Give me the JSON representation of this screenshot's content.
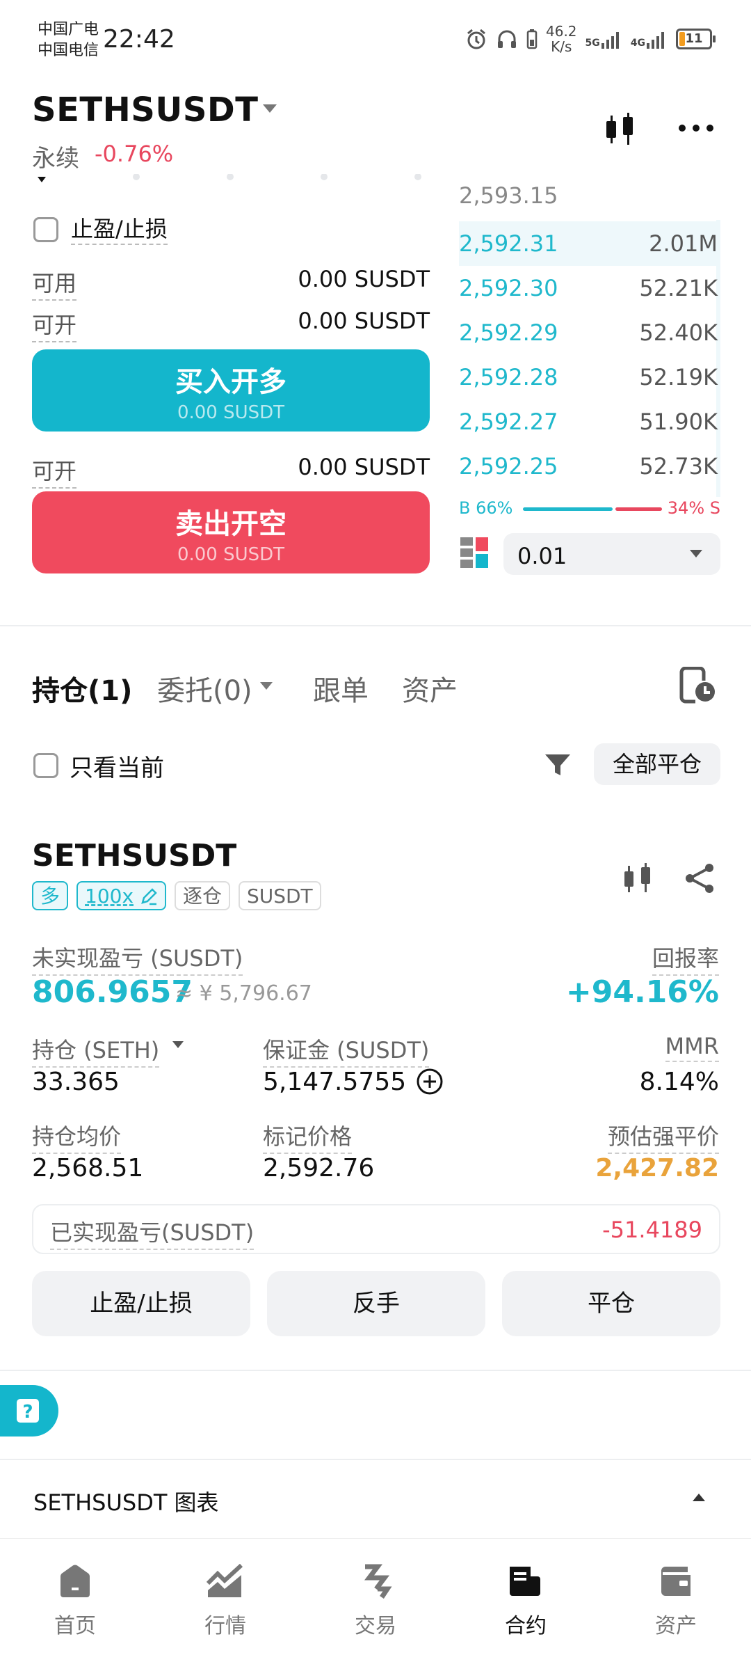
{
  "status_bar": {
    "carrier1": "中国广电",
    "carrier2": "中国电信",
    "time": "22:42",
    "speed_value": "46.2",
    "speed_unit": "K/s",
    "net1": "5G",
    "net2": "4G",
    "battery": "11"
  },
  "header": {
    "symbol": "SETHSUSDT",
    "contract_type": "永续",
    "change": "-0.76%"
  },
  "order_form": {
    "tpsl_label": "止盈/止损",
    "available_label": "可用",
    "available_value": "0.00 SUSDT",
    "open_long_label": "可开",
    "open_long_value": "0.00 SUSDT",
    "buy_button": "买入开多",
    "buy_sub": "0.00 SUSDT",
    "open_short_label": "可开",
    "open_short_value": "0.00 SUSDT",
    "sell_button": "卖出开空",
    "sell_sub": "0.00 SUSDT"
  },
  "orderbook": {
    "last_price": "2,593.15",
    "rows": [
      {
        "price": "2,592.31",
        "size": "2.01M"
      },
      {
        "price": "2,592.30",
        "size": "52.21K"
      },
      {
        "price": "2,592.29",
        "size": "52.40K"
      },
      {
        "price": "2,592.28",
        "size": "52.19K"
      },
      {
        "price": "2,592.27",
        "size": "51.90K"
      },
      {
        "price": "2,592.25",
        "size": "52.73K"
      }
    ],
    "buy_ratio": "B 66%",
    "sell_ratio": "34% S",
    "buy_fraction": 0.66,
    "depth": "0.01"
  },
  "tabs": {
    "positions": "持仓(1)",
    "orders": "委托(0)",
    "copy": "跟单",
    "assets": "资产"
  },
  "filter": {
    "only_current": "只看当前",
    "close_all": "全部平仓"
  },
  "position": {
    "symbol": "SETHSUSDT",
    "side": "多",
    "leverage": "100x",
    "margin_mode": "逐仓",
    "currency": "SUSDT",
    "unrealized_label": "未实现盈亏 (SUSDT)",
    "unrealized_value": "806.9657",
    "unrealized_cny": "≈ ¥ 5,796.67",
    "roe_label": "回报率",
    "roe_value": "+94.16%",
    "size_label": "持仓 (SETH)",
    "size_value": "33.365",
    "margin_label": "保证金 (SUSDT)",
    "margin_value": "5,147.5755",
    "mmr_label": "MMR",
    "mmr_value": "8.14%",
    "entry_label": "持仓均价",
    "entry_value": "2,568.51",
    "mark_label": "标记价格",
    "mark_value": "2,592.76",
    "liq_label": "预估强平价",
    "liq_value": "2,427.82",
    "realized_label": "已实现盈亏(SUSDT)",
    "realized_value": "-51.4189",
    "btn_tpsl": "止盈/止损",
    "btn_reverse": "反手",
    "btn_close": "平仓"
  },
  "chart_section": {
    "title": "SETHSUSDT 图表"
  },
  "nav": {
    "home": "首页",
    "market": "行情",
    "trade": "交易",
    "futures": "合约",
    "assets": "资产"
  },
  "colors": {
    "accent": "#1fb8cc",
    "sell": "#e8475e",
    "warning": "#e9a33b"
  }
}
